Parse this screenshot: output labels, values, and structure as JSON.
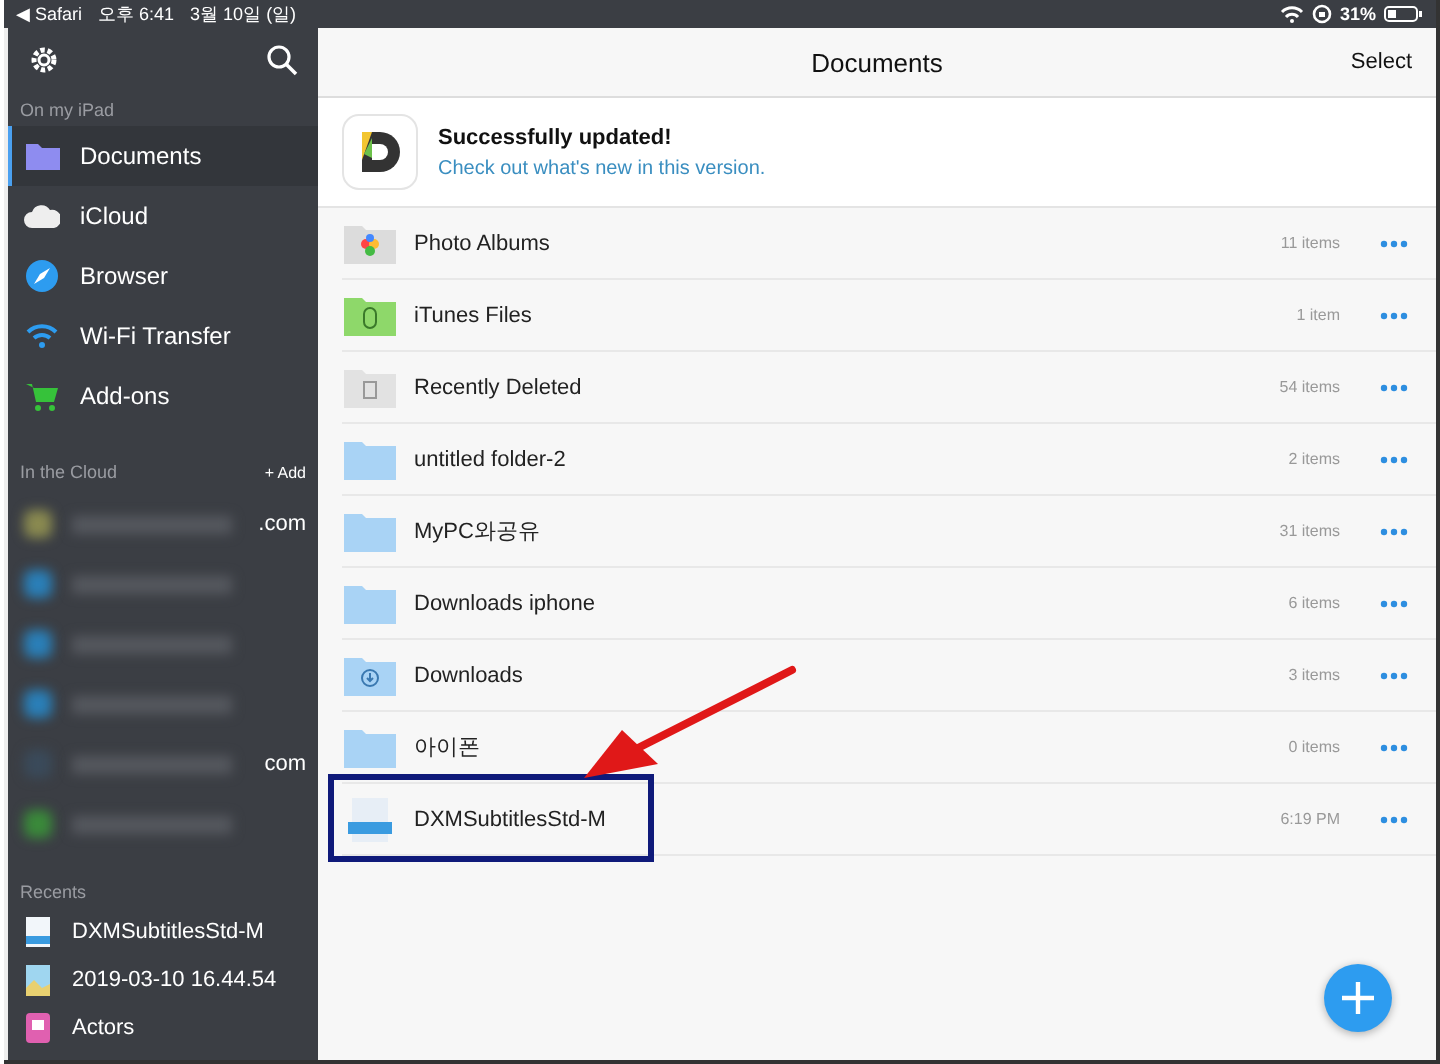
{
  "status_bar": {
    "back": "◀",
    "app": "Safari",
    "time": "오후 6:41",
    "date": "3월 10일 (일)",
    "battery": "31%"
  },
  "sidebar": {
    "sections": [
      {
        "title": "On my iPad",
        "items": [
          {
            "label": "Documents",
            "kind": "folder",
            "selected": true
          },
          {
            "label": "iCloud",
            "kind": "cloud",
            "selected": false
          },
          {
            "label": "Browser",
            "kind": "compass",
            "selected": false
          },
          {
            "label": "Wi-Fi Transfer",
            "kind": "wifi",
            "selected": false
          },
          {
            "label": "Add-ons",
            "kind": "cart",
            "selected": false
          }
        ]
      }
    ],
    "cloud": {
      "title": "In the Cloud",
      "add": "+ Add",
      "accounts": [
        {
          "color": "#8a8a50",
          "suffix": ".com"
        },
        {
          "color": "#2a7fb8"
        },
        {
          "color": "#2a7fb8"
        },
        {
          "color": "#2a7fb8"
        },
        {
          "color": "#3a4a5a",
          "suffix": "com"
        },
        {
          "color": "#3a8a3a"
        }
      ]
    },
    "recents": {
      "title": "Recents",
      "items": [
        {
          "label": "DXMSubtitlesStd-M",
          "kind": "file"
        },
        {
          "label": "2019-03-10 16.44.54",
          "kind": "image"
        },
        {
          "label": "Actors",
          "kind": "app"
        }
      ]
    }
  },
  "nav": {
    "title": "Documents",
    "action": "Select"
  },
  "banner": {
    "title": "Successfully updated!",
    "link": "Check out what's new in this version."
  },
  "files": [
    {
      "name": "Photo Albums",
      "kind": "photos",
      "info": "11 items"
    },
    {
      "name": "iTunes Files",
      "kind": "itunes",
      "info": "1 item"
    },
    {
      "name": "Recently Deleted",
      "kind": "trash",
      "info": "54 items"
    },
    {
      "name": "untitled folder-2",
      "kind": "folder",
      "info": "2 items"
    },
    {
      "name": "MyPC와공유",
      "kind": "folder",
      "info": "31 items"
    },
    {
      "name": "Downloads iphone",
      "kind": "folder",
      "info": "6 items"
    },
    {
      "name": "Downloads",
      "kind": "download",
      "info": "3 items"
    },
    {
      "name": "아이폰",
      "kind": "folder",
      "info": "0 items"
    },
    {
      "name": "DXMSubtitlesStd-M",
      "kind": "otf",
      "info": "6:19 PM",
      "highlighted": true
    }
  ]
}
